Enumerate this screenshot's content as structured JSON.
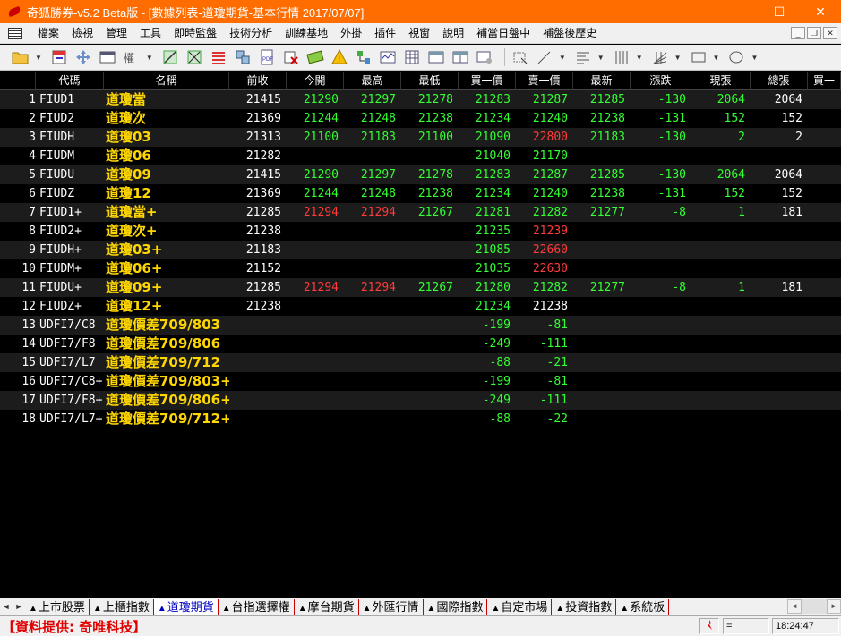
{
  "window": {
    "title": "奇狐勝券-v5.2 Beta版 - [數據列表-道瓊期貨-基本行情 2017/07/07]",
    "minimize": "—",
    "maximize": "☐",
    "close": "✕"
  },
  "menu": {
    "items": [
      "檔案",
      "檢視",
      "管理",
      "工具",
      "即時監盤",
      "技術分析",
      "訓練基地",
      "外掛",
      "插件",
      "視窗",
      "說明",
      "補當日盤中",
      "補盤後歷史"
    ]
  },
  "mdi": {
    "minimize": "_",
    "restore": "❐",
    "close": "✕"
  },
  "table": {
    "headers": [
      "",
      "代碼",
      "名稱",
      "前收",
      "今開",
      "最高",
      "最低",
      "買一價",
      "賣一價",
      "最新",
      "漲跌",
      "現張",
      "總張",
      "買一"
    ],
    "rows": [
      {
        "idx": "1",
        "code": "FIUD1",
        "name": "道瓊當",
        "cells": [
          [
            "21415",
            "w"
          ],
          [
            "21290",
            "g"
          ],
          [
            "21297",
            "g"
          ],
          [
            "21278",
            "g"
          ],
          [
            "21283",
            "g"
          ],
          [
            "21287",
            "g"
          ],
          [
            "21285",
            "g"
          ],
          [
            "-130",
            "g"
          ],
          [
            "2064",
            "g"
          ],
          [
            "2064",
            "w"
          ]
        ]
      },
      {
        "idx": "2",
        "code": "FIUD2",
        "name": "道瓊次",
        "cells": [
          [
            "21369",
            "w"
          ],
          [
            "21244",
            "g"
          ],
          [
            "21248",
            "g"
          ],
          [
            "21238",
            "g"
          ],
          [
            "21234",
            "g"
          ],
          [
            "21240",
            "g"
          ],
          [
            "21238",
            "g"
          ],
          [
            "-131",
            "g"
          ],
          [
            "152",
            "g"
          ],
          [
            "152",
            "w"
          ]
        ]
      },
      {
        "idx": "3",
        "code": "FIUDH",
        "name": "道瓊03",
        "cells": [
          [
            "21313",
            "w"
          ],
          [
            "21100",
            "g"
          ],
          [
            "21183",
            "g"
          ],
          [
            "21100",
            "g"
          ],
          [
            "21090",
            "g"
          ],
          [
            "22800",
            "r"
          ],
          [
            "21183",
            "g"
          ],
          [
            "-130",
            "g"
          ],
          [
            "2",
            "g"
          ],
          [
            "2",
            "w"
          ]
        ]
      },
      {
        "idx": "4",
        "code": "FIUDM",
        "name": "道瓊06",
        "cells": [
          [
            "21282",
            "w"
          ],
          [
            "",
            ""
          ],
          [
            "",
            ""
          ],
          [
            "",
            ""
          ],
          [
            "21040",
            "g"
          ],
          [
            "21170",
            "g"
          ],
          [
            "",
            ""
          ],
          [
            "",
            ""
          ],
          [
            "",
            ""
          ],
          [
            "",
            ""
          ]
        ]
      },
      {
        "idx": "5",
        "code": "FIUDU",
        "name": "道瓊09",
        "cells": [
          [
            "21415",
            "w"
          ],
          [
            "21290",
            "g"
          ],
          [
            "21297",
            "g"
          ],
          [
            "21278",
            "g"
          ],
          [
            "21283",
            "g"
          ],
          [
            "21287",
            "g"
          ],
          [
            "21285",
            "g"
          ],
          [
            "-130",
            "g"
          ],
          [
            "2064",
            "g"
          ],
          [
            "2064",
            "w"
          ]
        ]
      },
      {
        "idx": "6",
        "code": "FIUDZ",
        "name": "道瓊12",
        "cells": [
          [
            "21369",
            "w"
          ],
          [
            "21244",
            "g"
          ],
          [
            "21248",
            "g"
          ],
          [
            "21238",
            "g"
          ],
          [
            "21234",
            "g"
          ],
          [
            "21240",
            "g"
          ],
          [
            "21238",
            "g"
          ],
          [
            "-131",
            "g"
          ],
          [
            "152",
            "g"
          ],
          [
            "152",
            "w"
          ]
        ]
      },
      {
        "idx": "7",
        "code": "FIUD1+",
        "name": "道瓊當+",
        "cells": [
          [
            "21285",
            "w"
          ],
          [
            "21294",
            "r"
          ],
          [
            "21294",
            "r"
          ],
          [
            "21267",
            "g"
          ],
          [
            "21281",
            "g"
          ],
          [
            "21282",
            "g"
          ],
          [
            "21277",
            "g"
          ],
          [
            "-8",
            "g"
          ],
          [
            "1",
            "g"
          ],
          [
            "181",
            "w"
          ]
        ]
      },
      {
        "idx": "8",
        "code": "FIUD2+",
        "name": "道瓊次+",
        "cells": [
          [
            "21238",
            "w"
          ],
          [
            "",
            ""
          ],
          [
            "",
            ""
          ],
          [
            "",
            ""
          ],
          [
            "21235",
            "g"
          ],
          [
            "21239",
            "r"
          ],
          [
            "",
            ""
          ],
          [
            "",
            ""
          ],
          [
            "",
            ""
          ],
          [
            "",
            ""
          ]
        ]
      },
      {
        "idx": "9",
        "code": "FIUDH+",
        "name": "道瓊03+",
        "cells": [
          [
            "21183",
            "w"
          ],
          [
            "",
            ""
          ],
          [
            "",
            ""
          ],
          [
            "",
            ""
          ],
          [
            "21085",
            "g"
          ],
          [
            "22660",
            "r"
          ],
          [
            "",
            ""
          ],
          [
            "",
            ""
          ],
          [
            "",
            ""
          ],
          [
            "",
            ""
          ]
        ]
      },
      {
        "idx": "10",
        "code": "FIUDM+",
        "name": "道瓊06+",
        "cells": [
          [
            "21152",
            "w"
          ],
          [
            "",
            ""
          ],
          [
            "",
            ""
          ],
          [
            "",
            ""
          ],
          [
            "21035",
            "g"
          ],
          [
            "22630",
            "r"
          ],
          [
            "",
            ""
          ],
          [
            "",
            ""
          ],
          [
            "",
            ""
          ],
          [
            "",
            ""
          ]
        ]
      },
      {
        "idx": "11",
        "code": "FIUDU+",
        "name": "道瓊09+",
        "cells": [
          [
            "21285",
            "w"
          ],
          [
            "21294",
            "r"
          ],
          [
            "21294",
            "r"
          ],
          [
            "21267",
            "g"
          ],
          [
            "21280",
            "g"
          ],
          [
            "21282",
            "g"
          ],
          [
            "21277",
            "g"
          ],
          [
            "-8",
            "g"
          ],
          [
            "1",
            "g"
          ],
          [
            "181",
            "w"
          ]
        ]
      },
      {
        "idx": "12",
        "code": "FIUDZ+",
        "name": "道瓊12+",
        "cells": [
          [
            "21238",
            "w"
          ],
          [
            "",
            ""
          ],
          [
            "",
            ""
          ],
          [
            "",
            ""
          ],
          [
            "21234",
            "g"
          ],
          [
            "21238",
            "w"
          ],
          [
            "",
            ""
          ],
          [
            "",
            ""
          ],
          [
            "",
            ""
          ],
          [
            "",
            ""
          ]
        ]
      },
      {
        "idx": "13",
        "code": "UDFI7/C8",
        "name": "道瓊價差709/803",
        "cells": [
          [
            "",
            ""
          ],
          [
            "",
            ""
          ],
          [
            "",
            ""
          ],
          [
            "",
            ""
          ],
          [
            "-199",
            "g"
          ],
          [
            "-81",
            "g"
          ],
          [
            "",
            ""
          ],
          [
            "",
            ""
          ],
          [
            "",
            ""
          ],
          [
            "",
            ""
          ]
        ]
      },
      {
        "idx": "14",
        "code": "UDFI7/F8",
        "name": "道瓊價差709/806",
        "cells": [
          [
            "",
            ""
          ],
          [
            "",
            ""
          ],
          [
            "",
            ""
          ],
          [
            "",
            ""
          ],
          [
            "-249",
            "g"
          ],
          [
            "-111",
            "g"
          ],
          [
            "",
            ""
          ],
          [
            "",
            ""
          ],
          [
            "",
            ""
          ],
          [
            "",
            ""
          ]
        ]
      },
      {
        "idx": "15",
        "code": "UDFI7/L7",
        "name": "道瓊價差709/712",
        "cells": [
          [
            "",
            ""
          ],
          [
            "",
            ""
          ],
          [
            "",
            ""
          ],
          [
            "",
            ""
          ],
          [
            "-88",
            "g"
          ],
          [
            "-21",
            "g"
          ],
          [
            "",
            ""
          ],
          [
            "",
            ""
          ],
          [
            "",
            ""
          ],
          [
            "",
            ""
          ]
        ]
      },
      {
        "idx": "16",
        "code": "UDFI7/C8+",
        "name": "道瓊價差709/803+",
        "cells": [
          [
            "",
            ""
          ],
          [
            "",
            ""
          ],
          [
            "",
            ""
          ],
          [
            "",
            ""
          ],
          [
            "-199",
            "g"
          ],
          [
            "-81",
            "g"
          ],
          [
            "",
            ""
          ],
          [
            "",
            ""
          ],
          [
            "",
            ""
          ],
          [
            "",
            ""
          ]
        ]
      },
      {
        "idx": "17",
        "code": "UDFI7/F8+",
        "name": "道瓊價差709/806+",
        "cells": [
          [
            "",
            ""
          ],
          [
            "",
            ""
          ],
          [
            "",
            ""
          ],
          [
            "",
            ""
          ],
          [
            "-249",
            "g"
          ],
          [
            "-111",
            "g"
          ],
          [
            "",
            ""
          ],
          [
            "",
            ""
          ],
          [
            "",
            ""
          ],
          [
            "",
            ""
          ]
        ]
      },
      {
        "idx": "18",
        "code": "UDFI7/L7+",
        "name": "道瓊價差709/712+",
        "cells": [
          [
            "",
            ""
          ],
          [
            "",
            ""
          ],
          [
            "",
            ""
          ],
          [
            "",
            ""
          ],
          [
            "-88",
            "g"
          ],
          [
            "-22",
            "g"
          ],
          [
            "",
            ""
          ],
          [
            "",
            ""
          ],
          [
            "",
            ""
          ],
          [
            "",
            ""
          ]
        ]
      }
    ]
  },
  "sheet_tabs": {
    "items": [
      "上市股票",
      "上櫃指數",
      "道瓊期貨",
      "台指選擇權",
      "摩台期貨",
      "外匯行情",
      "國際指數",
      "自定市場",
      "投資指數",
      "系統板"
    ],
    "active": 2,
    "triangle": "▲"
  },
  "status": {
    "provider": "【資料提供: 奇唯科技】",
    "indicator": "=",
    "time": "18:24:47"
  },
  "colors": {
    "titlebar": "#ff6d00",
    "up": "#ff3b3b",
    "down": "#33ff33",
    "name": "#ffd700",
    "provider": "#e00000"
  }
}
